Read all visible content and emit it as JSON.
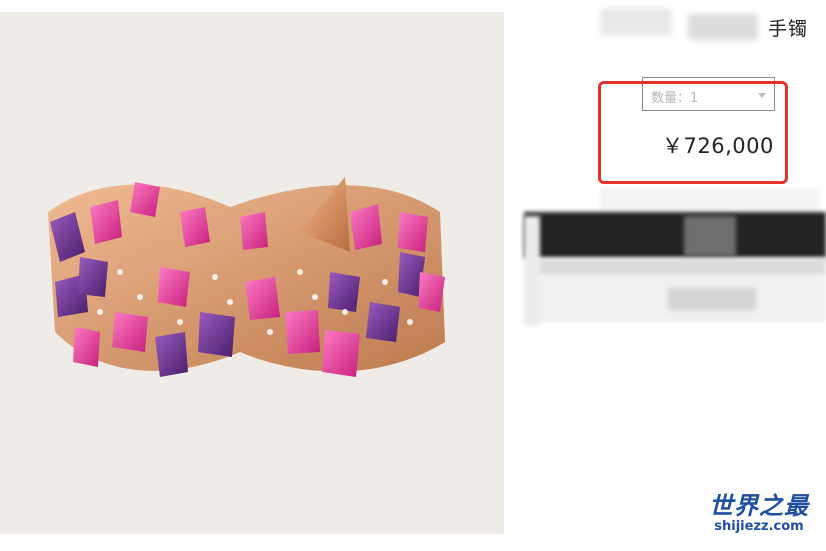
{
  "product": {
    "title": "手镯",
    "image_alt": "bracelet",
    "quantity_label": "数量：1",
    "price": "￥726,000"
  },
  "watermark": {
    "main": "世界之最",
    "sub": "shijiezz.com"
  },
  "colors": {
    "highlight": "#e5302b",
    "image_background": "#efebe7",
    "watermark": "#1f4fa3",
    "gem_pink": "#e23a9a",
    "gem_purple": "#6a2f8a",
    "gold": "#d9935f"
  }
}
